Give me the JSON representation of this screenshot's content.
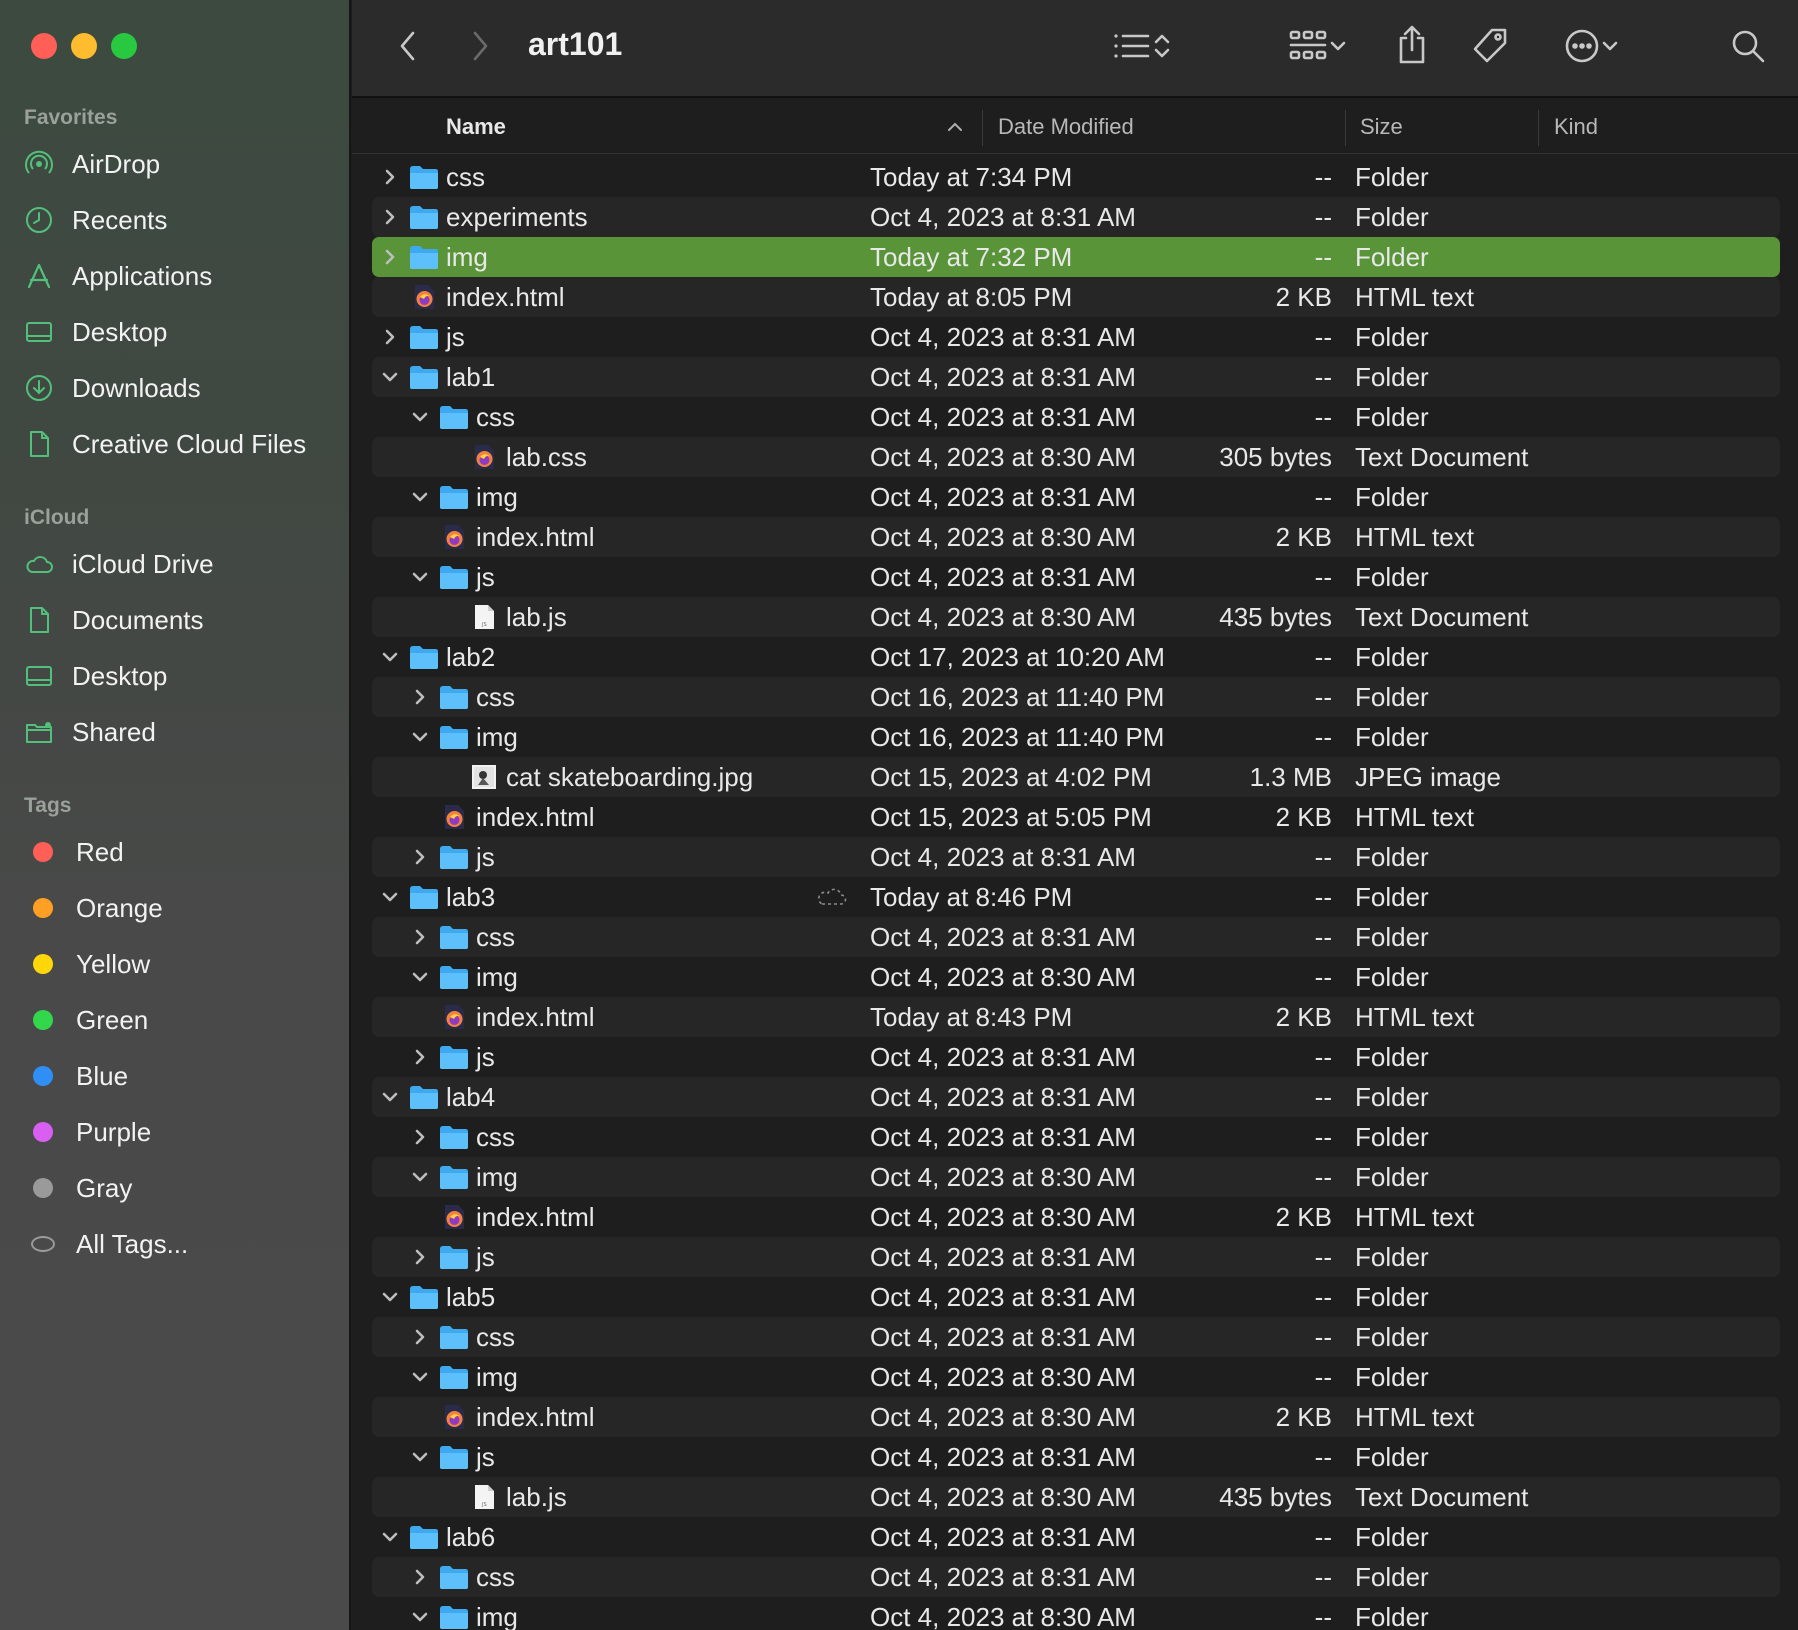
{
  "window": {
    "title": "art101"
  },
  "sidebar": {
    "favorites_label": "Favorites",
    "favorites": [
      {
        "label": "AirDrop",
        "icon": "airdrop-icon"
      },
      {
        "label": "Recents",
        "icon": "clock-icon"
      },
      {
        "label": "Applications",
        "icon": "applications-icon"
      },
      {
        "label": "Desktop",
        "icon": "desktop-icon"
      },
      {
        "label": "Downloads",
        "icon": "download-icon"
      },
      {
        "label": "Creative Cloud Files",
        "icon": "document-icon"
      }
    ],
    "icloud_label": "iCloud",
    "icloud": [
      {
        "label": "iCloud Drive",
        "icon": "cloud-icon"
      },
      {
        "label": "Documents",
        "icon": "document-icon"
      },
      {
        "label": "Desktop",
        "icon": "desktop-icon"
      },
      {
        "label": "Shared",
        "icon": "shared-folder-icon"
      }
    ],
    "tags_label": "Tags",
    "tags": [
      {
        "label": "Red",
        "color": "#ff5f57"
      },
      {
        "label": "Orange",
        "color": "#ffa024"
      },
      {
        "label": "Yellow",
        "color": "#ffd60a"
      },
      {
        "label": "Green",
        "color": "#32d74b"
      },
      {
        "label": "Blue",
        "color": "#2f8ff7"
      },
      {
        "label": "Purple",
        "color": "#d95ef2"
      },
      {
        "label": "Gray",
        "color": "#9a9a9a"
      },
      {
        "label": "All Tags...",
        "color": ""
      }
    ]
  },
  "columns": {
    "name": "Name",
    "date": "Date Modified",
    "size": "Size",
    "kind": "Kind"
  },
  "colors": {
    "selection": "#5a9439",
    "folder": "#3da9f0"
  },
  "files": [
    {
      "name": "css",
      "depth": 0,
      "expander": "collapsed",
      "icon": "folder",
      "date": "Today at 7:34 PM",
      "size": "--",
      "kind": "Folder"
    },
    {
      "name": "experiments",
      "depth": 0,
      "expander": "collapsed",
      "icon": "folder",
      "date": "Oct 4, 2023 at 8:31 AM",
      "size": "--",
      "kind": "Folder"
    },
    {
      "name": "img",
      "depth": 0,
      "expander": "collapsed",
      "icon": "folder",
      "date": "Today at 7:32 PM",
      "size": "--",
      "kind": "Folder",
      "selected": true
    },
    {
      "name": "index.html",
      "depth": 0,
      "expander": "none",
      "icon": "html",
      "date": "Today at 8:05 PM",
      "size": "2 KB",
      "kind": "HTML text"
    },
    {
      "name": "js",
      "depth": 0,
      "expander": "collapsed",
      "icon": "folder",
      "date": "Oct 4, 2023 at 8:31 AM",
      "size": "--",
      "kind": "Folder"
    },
    {
      "name": "lab1",
      "depth": 0,
      "expander": "expanded",
      "icon": "folder",
      "date": "Oct 4, 2023 at 8:31 AM",
      "size": "--",
      "kind": "Folder"
    },
    {
      "name": "css",
      "depth": 1,
      "expander": "expanded",
      "icon": "folder",
      "date": "Oct 4, 2023 at 8:31 AM",
      "size": "--",
      "kind": "Folder"
    },
    {
      "name": "lab.css",
      "depth": 2,
      "expander": "none",
      "icon": "html",
      "date": "Oct 4, 2023 at 8:30 AM",
      "size": "305 bytes",
      "kind": "Text Document"
    },
    {
      "name": "img",
      "depth": 1,
      "expander": "expanded",
      "icon": "folder",
      "date": "Oct 4, 2023 at 8:31 AM",
      "size": "--",
      "kind": "Folder"
    },
    {
      "name": "index.html",
      "depth": 1,
      "expander": "none",
      "icon": "html",
      "date": "Oct 4, 2023 at 8:30 AM",
      "size": "2 KB",
      "kind": "HTML text"
    },
    {
      "name": "js",
      "depth": 1,
      "expander": "expanded",
      "icon": "folder",
      "date": "Oct 4, 2023 at 8:31 AM",
      "size": "--",
      "kind": "Folder"
    },
    {
      "name": "lab.js",
      "depth": 2,
      "expander": "none",
      "icon": "js",
      "date": "Oct 4, 2023 at 8:30 AM",
      "size": "435 bytes",
      "kind": "Text Document"
    },
    {
      "name": "lab2",
      "depth": 0,
      "expander": "expanded",
      "icon": "folder",
      "date": "Oct 17, 2023 at 10:20 AM",
      "size": "--",
      "kind": "Folder"
    },
    {
      "name": "css",
      "depth": 1,
      "expander": "collapsed",
      "icon": "folder",
      "date": "Oct 16, 2023 at 11:40 PM",
      "size": "--",
      "kind": "Folder"
    },
    {
      "name": "img",
      "depth": 1,
      "expander": "expanded",
      "icon": "folder",
      "date": "Oct 16, 2023 at 11:40 PM",
      "size": "--",
      "kind": "Folder"
    },
    {
      "name": "cat skateboarding.jpg",
      "depth": 2,
      "expander": "none",
      "icon": "image",
      "date": "Oct 15, 2023 at 4:02 PM",
      "size": "1.3 MB",
      "kind": "JPEG image"
    },
    {
      "name": "index.html",
      "depth": 1,
      "expander": "none",
      "icon": "html",
      "date": "Oct 15, 2023 at 5:05 PM",
      "size": "2 KB",
      "kind": "HTML text"
    },
    {
      "name": "js",
      "depth": 1,
      "expander": "collapsed",
      "icon": "folder",
      "date": "Oct 4, 2023 at 8:31 AM",
      "size": "--",
      "kind": "Folder"
    },
    {
      "name": "lab3",
      "depth": 0,
      "expander": "expanded",
      "icon": "folder",
      "date": "Today at 8:46 PM",
      "size": "--",
      "kind": "Folder",
      "cloud": true
    },
    {
      "name": "css",
      "depth": 1,
      "expander": "collapsed",
      "icon": "folder",
      "date": "Oct 4, 2023 at 8:31 AM",
      "size": "--",
      "kind": "Folder"
    },
    {
      "name": "img",
      "depth": 1,
      "expander": "expanded",
      "icon": "folder",
      "date": "Oct 4, 2023 at 8:30 AM",
      "size": "--",
      "kind": "Folder"
    },
    {
      "name": "index.html",
      "depth": 1,
      "expander": "none",
      "icon": "html",
      "date": "Today at 8:43 PM",
      "size": "2 KB",
      "kind": "HTML text"
    },
    {
      "name": "js",
      "depth": 1,
      "expander": "collapsed",
      "icon": "folder",
      "date": "Oct 4, 2023 at 8:31 AM",
      "size": "--",
      "kind": "Folder"
    },
    {
      "name": "lab4",
      "depth": 0,
      "expander": "expanded",
      "icon": "folder",
      "date": "Oct 4, 2023 at 8:31 AM",
      "size": "--",
      "kind": "Folder"
    },
    {
      "name": "css",
      "depth": 1,
      "expander": "collapsed",
      "icon": "folder",
      "date": "Oct 4, 2023 at 8:31 AM",
      "size": "--",
      "kind": "Folder"
    },
    {
      "name": "img",
      "depth": 1,
      "expander": "expanded",
      "icon": "folder",
      "date": "Oct 4, 2023 at 8:30 AM",
      "size": "--",
      "kind": "Folder"
    },
    {
      "name": "index.html",
      "depth": 1,
      "expander": "none",
      "icon": "html",
      "date": "Oct 4, 2023 at 8:30 AM",
      "size": "2 KB",
      "kind": "HTML text"
    },
    {
      "name": "js",
      "depth": 1,
      "expander": "collapsed",
      "icon": "folder",
      "date": "Oct 4, 2023 at 8:31 AM",
      "size": "--",
      "kind": "Folder"
    },
    {
      "name": "lab5",
      "depth": 0,
      "expander": "expanded",
      "icon": "folder",
      "date": "Oct 4, 2023 at 8:31 AM",
      "size": "--",
      "kind": "Folder"
    },
    {
      "name": "css",
      "depth": 1,
      "expander": "collapsed",
      "icon": "folder",
      "date": "Oct 4, 2023 at 8:31 AM",
      "size": "--",
      "kind": "Folder"
    },
    {
      "name": "img",
      "depth": 1,
      "expander": "expanded",
      "icon": "folder",
      "date": "Oct 4, 2023 at 8:30 AM",
      "size": "--",
      "kind": "Folder"
    },
    {
      "name": "index.html",
      "depth": 1,
      "expander": "none",
      "icon": "html",
      "date": "Oct 4, 2023 at 8:30 AM",
      "size": "2 KB",
      "kind": "HTML text"
    },
    {
      "name": "js",
      "depth": 1,
      "expander": "expanded",
      "icon": "folder",
      "date": "Oct 4, 2023 at 8:31 AM",
      "size": "--",
      "kind": "Folder"
    },
    {
      "name": "lab.js",
      "depth": 2,
      "expander": "none",
      "icon": "js",
      "date": "Oct 4, 2023 at 8:30 AM",
      "size": "435 bytes",
      "kind": "Text Document"
    },
    {
      "name": "lab6",
      "depth": 0,
      "expander": "expanded",
      "icon": "folder",
      "date": "Oct 4, 2023 at 8:31 AM",
      "size": "--",
      "kind": "Folder"
    },
    {
      "name": "css",
      "depth": 1,
      "expander": "collapsed",
      "icon": "folder",
      "date": "Oct 4, 2023 at 8:31 AM",
      "size": "--",
      "kind": "Folder"
    },
    {
      "name": "img",
      "depth": 1,
      "expander": "expanded",
      "icon": "folder",
      "date": "Oct 4, 2023 at 8:30 AM",
      "size": "--",
      "kind": "Folder"
    }
  ]
}
